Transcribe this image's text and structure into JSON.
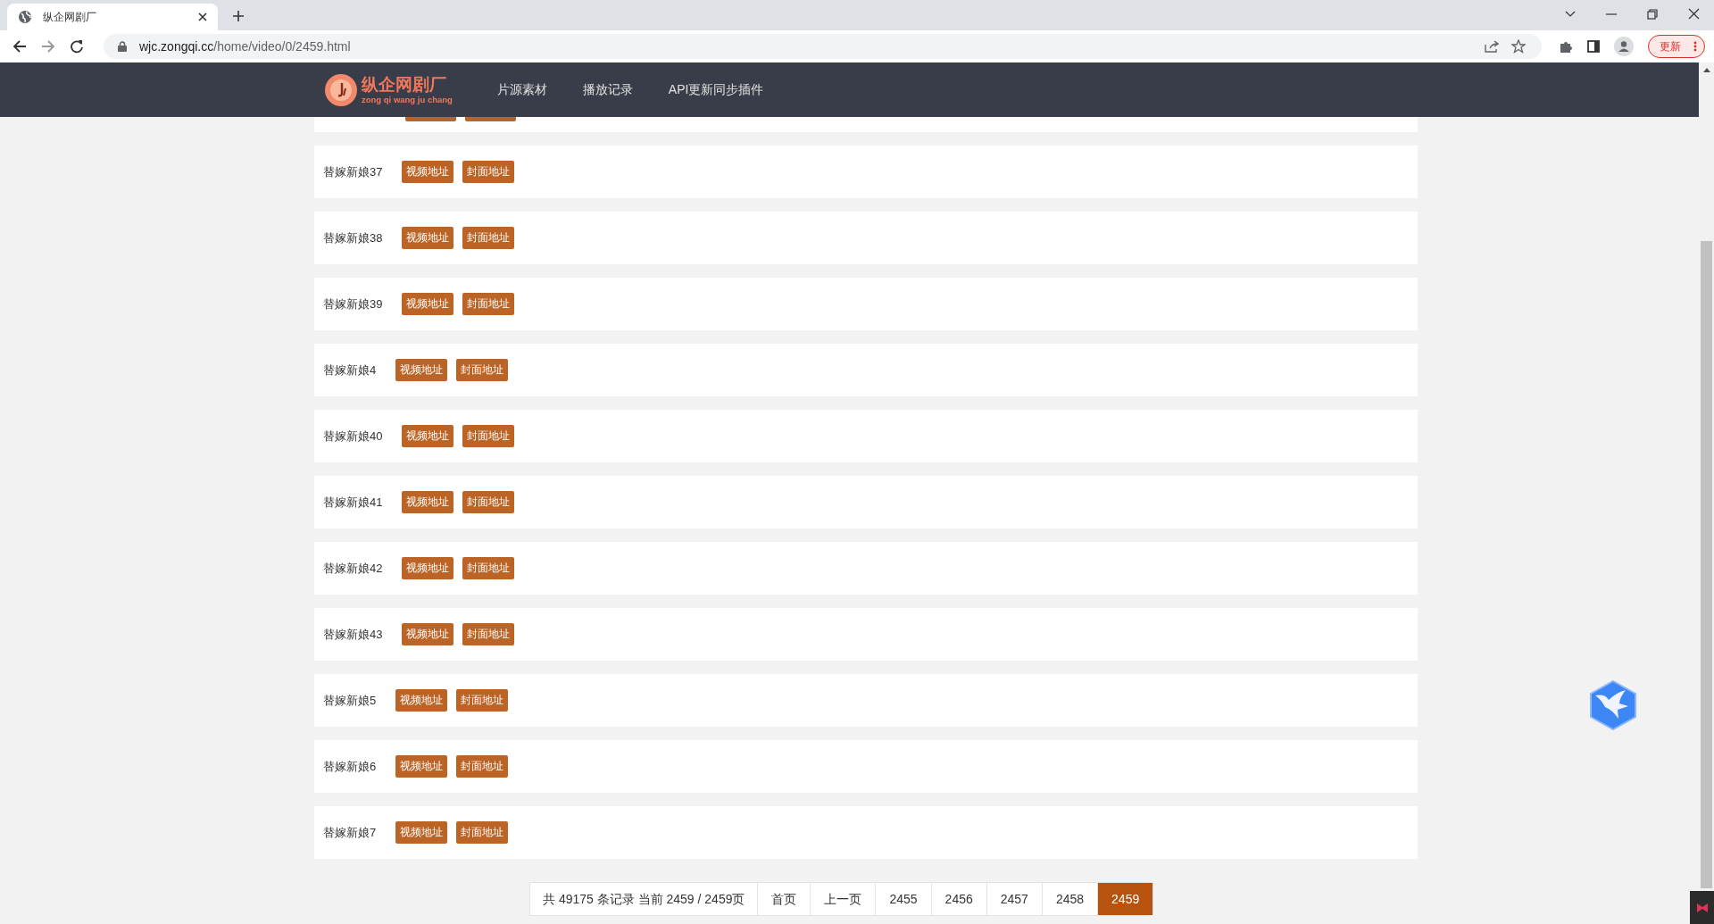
{
  "browser": {
    "tab_title": "纵企网剧厂",
    "url_host": "wjc.zongqi.cc",
    "url_path": "/home/video/0/2459.html",
    "update_button": "更新"
  },
  "header": {
    "logo_title": "纵企网剧厂",
    "logo_subtitle": "zong qi wang ju chang",
    "nav": [
      "片源素材",
      "播放记录",
      "API更新同步插件"
    ]
  },
  "videos": [
    {
      "title": "替嫁新娘37",
      "links": [
        "视频地址",
        "封面地址"
      ]
    },
    {
      "title": "替嫁新娘38",
      "links": [
        "视频地址",
        "封面地址"
      ]
    },
    {
      "title": "替嫁新娘39",
      "links": [
        "视频地址",
        "封面地址"
      ]
    },
    {
      "title": "替嫁新娘4",
      "links": [
        "视频地址",
        "封面地址"
      ]
    },
    {
      "title": "替嫁新娘40",
      "links": [
        "视频地址",
        "封面地址"
      ]
    },
    {
      "title": "替嫁新娘41",
      "links": [
        "视频地址",
        "封面地址"
      ]
    },
    {
      "title": "替嫁新娘42",
      "links": [
        "视频地址",
        "封面地址"
      ]
    },
    {
      "title": "替嫁新娘43",
      "links": [
        "视频地址",
        "封面地址"
      ]
    },
    {
      "title": "替嫁新娘5",
      "links": [
        "视频地址",
        "封面地址"
      ]
    },
    {
      "title": "替嫁新娘6",
      "links": [
        "视频地址",
        "封面地址"
      ]
    },
    {
      "title": "替嫁新娘7",
      "links": [
        "视频地址",
        "封面地址"
      ]
    }
  ],
  "pagination": {
    "summary": "共 49175 条记录 当前 2459 / 2459页",
    "pages": [
      {
        "label": "首页",
        "selected": false
      },
      {
        "label": "上一页",
        "selected": false
      },
      {
        "label": "2455",
        "selected": false
      },
      {
        "label": "2456",
        "selected": false
      },
      {
        "label": "2457",
        "selected": false
      },
      {
        "label": "2458",
        "selected": false
      },
      {
        "label": "2459",
        "selected": true
      }
    ]
  }
}
